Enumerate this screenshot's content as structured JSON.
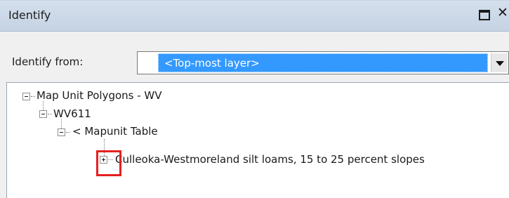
{
  "window": {
    "title": "Identify"
  },
  "toolbar": {
    "identify_from_label": "Identify from:",
    "identify_from_value": "<Top-most layer>"
  },
  "tree": {
    "layer": "Map Unit Polygons - WV",
    "feature": "WV611",
    "table": "< Mapunit Table",
    "record": "Culleoka-Westmoreland silt loams, 15 to 25 percent slopes"
  },
  "icons": {
    "maximize": "maximize-icon",
    "close": "close-icon",
    "dropdown": "chevron-down-icon",
    "collapse": "tree-collapse-icon",
    "expand": "tree-expand-icon"
  },
  "colors": {
    "selection": "#3399ff",
    "highlight": "#e52020",
    "titlebar": "#c5d3e4"
  }
}
